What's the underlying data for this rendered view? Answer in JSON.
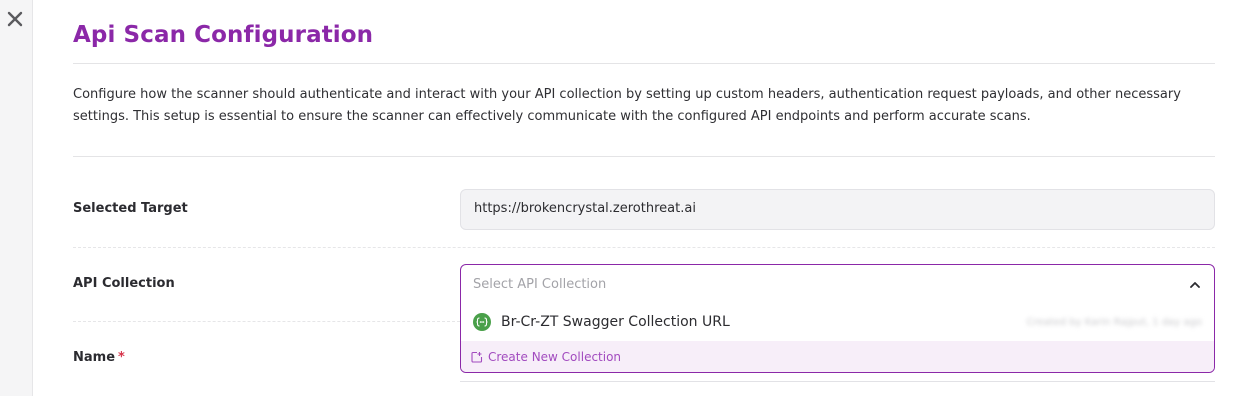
{
  "page": {
    "title": "Api Scan Configuration",
    "description": "Configure how the scanner should authenticate and interact with your API collection by setting up custom headers, authentication request payloads, and other necessary settings. This setup is essential to ensure the scanner can effectively communicate with the configured API endpoints and perform accurate scans."
  },
  "form": {
    "selected_target": {
      "label": "Selected Target",
      "value": "https://brokencrystal.zerothreat.ai"
    },
    "api_collection": {
      "label": "API Collection",
      "placeholder": "Select API Collection",
      "options": [
        {
          "label": "Br-Cr-ZT Swagger Collection URL",
          "meta": "Created by Karin Rajput, 1 day ago"
        }
      ],
      "create_label": "Create New Collection"
    },
    "name": {
      "label": "Name",
      "required_mark": "*"
    }
  },
  "colors": {
    "accent": "#8b28a8",
    "required": "#d6334a",
    "option_icon": "#4aa04a"
  },
  "icons": {
    "close": "close-icon",
    "chevron": "chevron-up-icon",
    "option": "api-collection-icon",
    "create": "external-add-icon"
  }
}
